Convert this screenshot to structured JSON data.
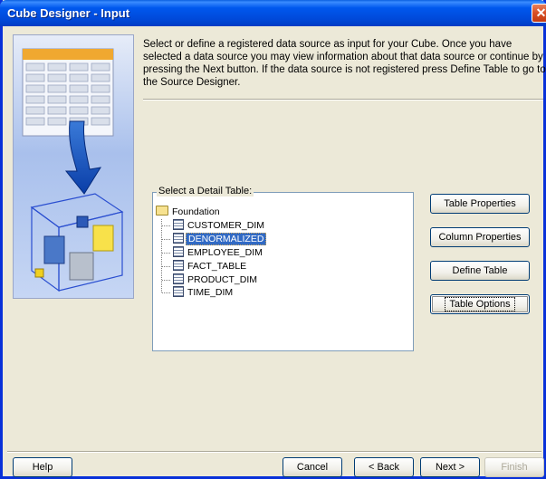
{
  "window": {
    "title": "Cube Designer - Input",
    "close_glyph": "✕"
  },
  "description": "Select or define a registered data source as input for your Cube. Once you have selected a data source you may view information about that data source or continue by pressing the Next button. If the data source is not registered press Define Table to go to the Source Designer.",
  "detail_table": {
    "label": "Select a Detail Table:",
    "root": {
      "label": "Foundation",
      "icon": "folder-icon"
    },
    "items": [
      {
        "label": "CUSTOMER_DIM",
        "icon": "table-icon",
        "selected": false
      },
      {
        "label": "DENORMALIZED",
        "icon": "table-icon",
        "selected": true
      },
      {
        "label": "EMPLOYEE_DIM",
        "icon": "table-icon",
        "selected": false
      },
      {
        "label": "FACT_TABLE",
        "icon": "table-icon",
        "selected": false
      },
      {
        "label": "PRODUCT_DIM",
        "icon": "table-icon",
        "selected": false
      },
      {
        "label": "TIME_DIM",
        "icon": "table-icon",
        "selected": false
      }
    ]
  },
  "side_buttons": {
    "table_properties": "Table Properties",
    "column_properties": "Column Properties",
    "define_table": "Define Table",
    "table_options": "Table Options"
  },
  "footer": {
    "help": "Help",
    "cancel": "Cancel",
    "back": "< Back",
    "next": "Next >",
    "finish": "Finish"
  },
  "colors": {
    "title_bar": "#0054e3",
    "selection": "#316ac5",
    "dialog_bg": "#ece9d8"
  }
}
